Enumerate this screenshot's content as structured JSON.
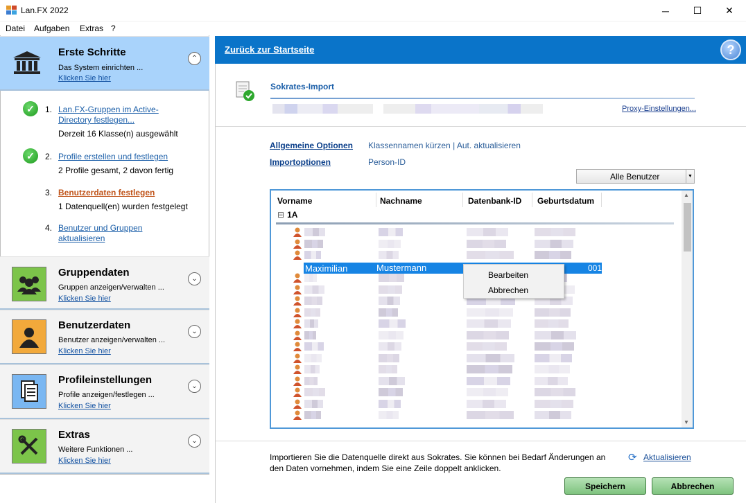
{
  "window": {
    "title": "Lan.FX 2022",
    "minimize": "─",
    "maximize": "☐",
    "close": "✕"
  },
  "menu": [
    "Datei",
    "Aufgaben",
    "Extras",
    "?"
  ],
  "sidebar": {
    "panels": [
      {
        "title": "Erste Schritte",
        "subtitle": "Das System einrichten ...",
        "link": "Klicken Sie hier",
        "toggle": "⌃"
      },
      {
        "title": "Gruppendaten",
        "subtitle": "Gruppen anzeigen/verwalten ...",
        "link": "Klicken Sie hier",
        "toggle": "⌄"
      },
      {
        "title": "Benutzerdaten",
        "subtitle": "Benutzer anzeigen/verwalten ...",
        "link": "Klicken Sie hier",
        "toggle": "⌄"
      },
      {
        "title": "Profileinstellungen",
        "subtitle": "Profile anzeigen/festlegen ...",
        "link": "Klicken Sie hier",
        "toggle": "⌄"
      },
      {
        "title": "Extras",
        "subtitle": "Weitere Funktionen ...",
        "link": "Klicken Sie hier",
        "toggle": "⌄"
      }
    ],
    "steps": [
      {
        "num": "1.",
        "link_line1": "Lan.FX-Gruppen im Active-",
        "link_line2": "Directory festlegen...",
        "info": "Derzeit 16 Klasse(n) ausgewählt",
        "check": "✓"
      },
      {
        "num": "2.",
        "link_line1": "Profile erstellen und festlegen",
        "info": "2 Profile gesamt, 2 davon fertig",
        "check": "✓"
      },
      {
        "num": "3.",
        "link_line1": "Benutzerdaten festlegen",
        "info": "1 Datenquell(en) wurden festgelegt"
      },
      {
        "num": "4.",
        "link_line1": "Benutzer und Gruppen",
        "link_line2": "aktualisieren"
      }
    ]
  },
  "main": {
    "back_link": "Zurück zur Startseite",
    "help": "?",
    "section_title": "Sokrates-Import",
    "proxy_link": "Proxy-Einstellungen...",
    "options": [
      {
        "label": "Allgemeine Optionen",
        "value": "Klassennamen kürzen | Aut. aktualisieren"
      },
      {
        "label": "Importoptionen",
        "value": "Person-ID"
      }
    ],
    "filter": {
      "value": "Alle Benutzer",
      "arrow": "▼"
    },
    "grid": {
      "columns": [
        "Vorname",
        "Nachname",
        "Datenbank-ID",
        "Geburtsdatum"
      ],
      "group": {
        "toggle": "⊟",
        "name": "1A"
      },
      "selected_row": {
        "first": "Maximilian",
        "last": "Mustermann",
        "birth_suffix": "001"
      },
      "scroll_up": "▲",
      "scroll_down": "▼"
    },
    "context_menu": [
      "Bearbeiten",
      "Abbrechen"
    ],
    "info_text": "Importieren Sie die Datenquelle direkt aus Sokrates. Sie können bei Bedarf Änderungen an den Daten vornehmen, indem Sie eine Zeile doppelt anklicken.",
    "refresh_icon": "⟳",
    "refresh_link": "Aktualisieren",
    "save_button": "Speichern",
    "cancel_button": "Abbrechen"
  }
}
